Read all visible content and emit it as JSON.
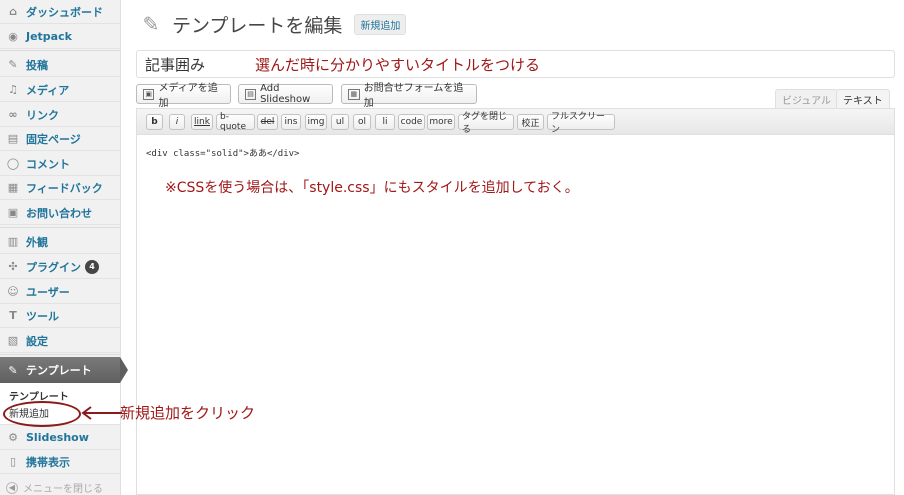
{
  "sidebar": {
    "items": [
      {
        "label": "ダッシュボード",
        "icon": "dashboard-icon",
        "glyph": "⌂"
      },
      {
        "label": "Jetpack",
        "icon": "jetpack-icon",
        "glyph": "◉"
      },
      {
        "label": "投稿",
        "icon": "pin-icon",
        "glyph": "✎"
      },
      {
        "label": "メディア",
        "icon": "media-icon",
        "glyph": "♫"
      },
      {
        "label": "リンク",
        "icon": "link-icon",
        "glyph": "∞"
      },
      {
        "label": "固定ページ",
        "icon": "page-icon",
        "glyph": "▤"
      },
      {
        "label": "コメント",
        "icon": "comment-icon",
        "glyph": "◯"
      },
      {
        "label": "フィードバック",
        "icon": "feedback-icon",
        "glyph": "▦"
      },
      {
        "label": "お問い合わせ",
        "icon": "contact-icon",
        "glyph": "▣"
      },
      {
        "label": "外観",
        "icon": "appearance-icon",
        "glyph": "▥"
      },
      {
        "label": "プラグイン",
        "icon": "plugin-icon",
        "glyph": "✣"
      },
      {
        "label": "ユーザー",
        "icon": "users-icon",
        "glyph": "☺"
      },
      {
        "label": "ツール",
        "icon": "tools-icon",
        "glyph": "T"
      },
      {
        "label": "設定",
        "icon": "settings-icon",
        "glyph": "▧"
      }
    ],
    "plugins_badge": "4",
    "active": {
      "label": "テンプレート",
      "icon": "pin-icon",
      "glyph": "✎"
    },
    "submenu": [
      "テンプレート",
      "新規追加"
    ],
    "after_items": [
      {
        "label": "Slideshow",
        "icon": "gear-icon",
        "glyph": "⚙"
      },
      {
        "label": "携帯表示",
        "icon": "mobile-icon",
        "glyph": "▯"
      }
    ],
    "collapse_label": "メニューを閉じる"
  },
  "header": {
    "title": "テンプレートを編集",
    "add_new": "新規追加"
  },
  "title_field": {
    "value": "記事囲み"
  },
  "media_buttons": {
    "add_media": "メディアを追加",
    "add_slideshow": "Add Slideshow",
    "add_contact_form": "お問合せフォームを追加"
  },
  "editor_tabs": {
    "visual": "ビジュアル",
    "text": "テキスト"
  },
  "quicktags": [
    "b",
    "i",
    "link",
    "b-quote",
    "del",
    "ins",
    "img",
    "ul",
    "ol",
    "li",
    "code",
    "more",
    "タグを閉じる",
    "校正",
    "フルスクリーン"
  ],
  "editor_content": "<div class=\"solid\">ああ</div>",
  "annotations": {
    "title_note": "選んだ時に分かりやすいタイトルをつける",
    "css_note": "※CSSを使う場合は、「style.css」にもスタイルを追加しておく。",
    "click_note": "新規追加をクリック"
  },
  "colors": {
    "annotation": "#a01818",
    "link": "#21759b",
    "active_menu": "#6b6b6b"
  }
}
